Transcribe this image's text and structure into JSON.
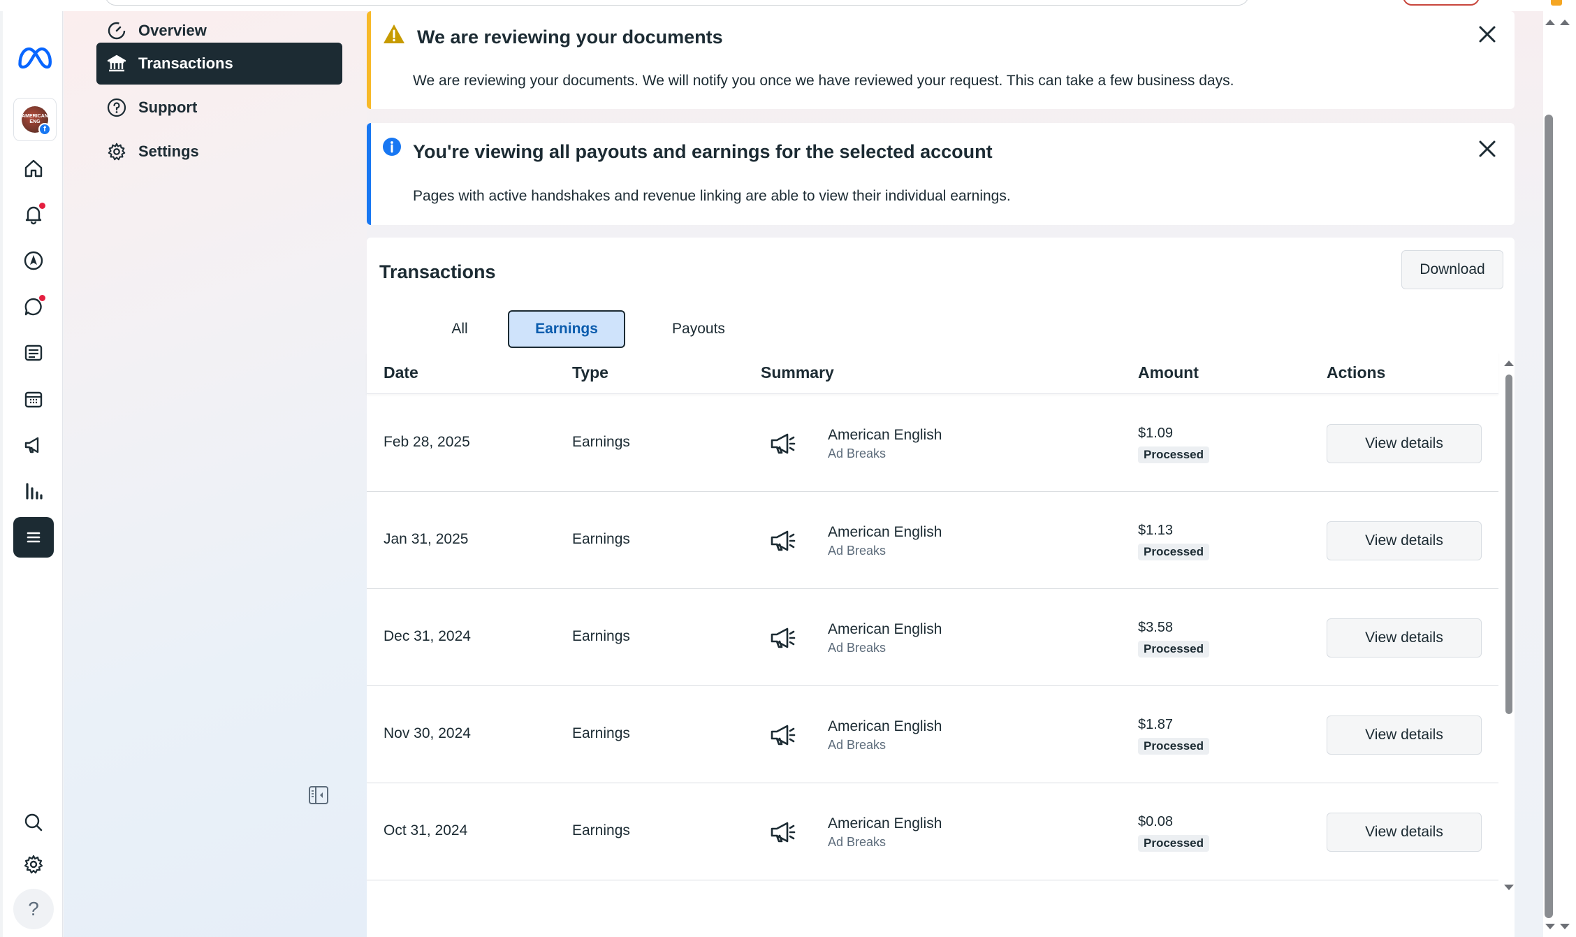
{
  "app": {
    "icons": {
      "logo": "meta-logo-icon",
      "home": "home-icon",
      "notifications": "bell-icon",
      "explore": "compass-icon",
      "messages": "chat-icon",
      "content": "content-icon",
      "calendar": "calendar-icon",
      "ads": "megaphone-icon",
      "insights": "bar-chart-icon",
      "menu": "menu-icon",
      "search": "search-icon",
      "settings": "gear-icon",
      "help": "help-icon"
    },
    "avatar_text": "AMERICAN ENG"
  },
  "subnav": {
    "items": [
      {
        "label": "Overview",
        "icon": "gauge-icon"
      },
      {
        "label": "Transactions",
        "icon": "bank-icon",
        "active": true
      },
      {
        "label": "Support",
        "icon": "question-circle-icon"
      },
      {
        "label": "Settings",
        "icon": "gear-icon"
      }
    ]
  },
  "banners": {
    "review": {
      "title": "We are reviewing your documents",
      "body": "We are reviewing your documents. We will notify you once we have reviewed your request. This can take a few business days.",
      "accent": "#f7b928"
    },
    "info": {
      "title": "You're viewing all payouts and earnings for the selected account",
      "body": "Pages with active handshakes and revenue linking are able to view their individual earnings.",
      "accent": "#1877f2"
    }
  },
  "transactions": {
    "title": "Transactions",
    "download_label": "Download",
    "tabs": [
      {
        "label": "All"
      },
      {
        "label": "Earnings",
        "active": true
      },
      {
        "label": "Payouts"
      }
    ],
    "columns": [
      "Date",
      "Type",
      "Summary",
      "Amount",
      "Actions"
    ],
    "rows": [
      {
        "date": "Feb 28, 2025",
        "type": "Earnings",
        "summary_title": "American English",
        "summary_sub": "Ad Breaks",
        "amount": "$1.09",
        "status": "Processed",
        "action": "View details"
      },
      {
        "date": "Jan 31, 2025",
        "type": "Earnings",
        "summary_title": "American English",
        "summary_sub": "Ad Breaks",
        "amount": "$1.13",
        "status": "Processed",
        "action": "View details"
      },
      {
        "date": "Dec 31, 2024",
        "type": "Earnings",
        "summary_title": "American English",
        "summary_sub": "Ad Breaks",
        "amount": "$3.58",
        "status": "Processed",
        "action": "View details"
      },
      {
        "date": "Nov 30, 2024",
        "type": "Earnings",
        "summary_title": "American English",
        "summary_sub": "Ad Breaks",
        "amount": "$1.87",
        "status": "Processed",
        "action": "View details"
      },
      {
        "date": "Oct 31, 2024",
        "type": "Earnings",
        "summary_title": "American English",
        "summary_sub": "Ad Breaks",
        "amount": "$0.08",
        "status": "Processed",
        "action": "View details"
      }
    ]
  }
}
